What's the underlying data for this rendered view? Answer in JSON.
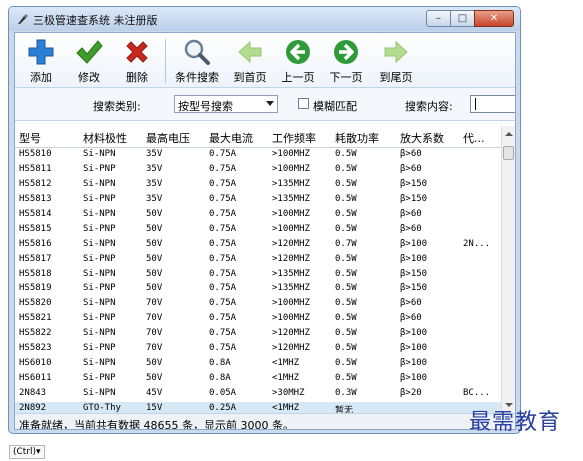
{
  "window": {
    "title": "三极管速查系统 未注册版",
    "minimize": "–",
    "maximize": "□",
    "close": "✕"
  },
  "toolbar": {
    "add": "添加",
    "edit": "修改",
    "delete": "删除",
    "search": "条件搜索",
    "first": "到首页",
    "prev": "上一页",
    "next": "下一页",
    "last": "到尾页"
  },
  "search": {
    "category_label": "搜索类别:",
    "category_value": "按型号搜索",
    "fuzzy_label": "模糊匹配",
    "content_label": "搜索内容:",
    "content_value": ""
  },
  "table": {
    "columns": [
      "型号",
      "材料极性",
      "最高电压",
      "最大电流",
      "工作频率",
      "耗散功率",
      "放大系数",
      "代..."
    ],
    "rows": [
      [
        "HS5810",
        "Si-NPN",
        "35V",
        "0.75A",
        ">100MHZ",
        "0.5W",
        "β>60",
        ""
      ],
      [
        "HS5811",
        "Si-PNP",
        "35V",
        "0.75A",
        ">100MHZ",
        "0.5W",
        "β>60",
        ""
      ],
      [
        "HS5812",
        "Si-NPN",
        "35V",
        "0.75A",
        ">135MHZ",
        "0.5W",
        "β>150",
        ""
      ],
      [
        "HS5813",
        "Si-PNP",
        "35V",
        "0.75A",
        ">135MHZ",
        "0.5W",
        "β>150",
        ""
      ],
      [
        "HS5814",
        "Si-NPN",
        "50V",
        "0.75A",
        ">100MHZ",
        "0.5W",
        "β>60",
        ""
      ],
      [
        "HS5815",
        "Si-PNP",
        "50V",
        "0.75A",
        ">100MHZ",
        "0.5W",
        "β>60",
        ""
      ],
      [
        "HS5816",
        "Si-NPN",
        "50V",
        "0.75A",
        ">120MHZ",
        "0.7W",
        "β>100",
        "2N..."
      ],
      [
        "HS5817",
        "Si-PNP",
        "50V",
        "0.75A",
        ">120MHZ",
        "0.5W",
        "β>100",
        ""
      ],
      [
        "HS5818",
        "Si-NPN",
        "50V",
        "0.75A",
        ">135MHZ",
        "0.5W",
        "β>150",
        ""
      ],
      [
        "HS5819",
        "Si-PNP",
        "50V",
        "0.75A",
        ">135MHZ",
        "0.5W",
        "β>150",
        ""
      ],
      [
        "HS5820",
        "Si-NPN",
        "70V",
        "0.75A",
        ">100MHZ",
        "0.5W",
        "β>60",
        ""
      ],
      [
        "HS5821",
        "Si-PNP",
        "70V",
        "0.75A",
        ">100MHZ",
        "0.5W",
        "β>60",
        ""
      ],
      [
        "HS5822",
        "Si-NPN",
        "70V",
        "0.75A",
        ">120MHZ",
        "0.5W",
        "β>100",
        ""
      ],
      [
        "HS5823",
        "Si-PNP",
        "70V",
        "0.75A",
        ">120MHZ",
        "0.5W",
        "β>100",
        ""
      ],
      [
        "HS6010",
        "Si-NPN",
        "50V",
        "0.8A",
        "<1MHZ",
        "0.5W",
        "β>100",
        ""
      ],
      [
        "HS6011",
        "Si-PNP",
        "50V",
        "0.8A",
        "<1MHZ",
        "0.5W",
        "β>100",
        ""
      ],
      [
        "2N843",
        "Si-NPN",
        "45V",
        "0.05A",
        ">30MHZ",
        "0.3W",
        "β>20",
        "BC..."
      ],
      [
        "2N892",
        "GTO-Thy",
        "15V",
        "0.25A",
        "<1MHZ",
        "暂无",
        "",
        " "
      ]
    ],
    "selected_row": 17
  },
  "status": {
    "text": "准备就绪，当前共有数据 48655 条，显示前 3000 条。"
  },
  "watermark": "最需教育",
  "ctrl_badge": "(Ctrl)▾",
  "colors": {
    "add_blue": "#2b7fd4",
    "edit_green": "#3f9e2a",
    "delete_red": "#c9281f",
    "nav_green": "#2f9a3a",
    "nav_disabled": "#b4dc8e"
  }
}
